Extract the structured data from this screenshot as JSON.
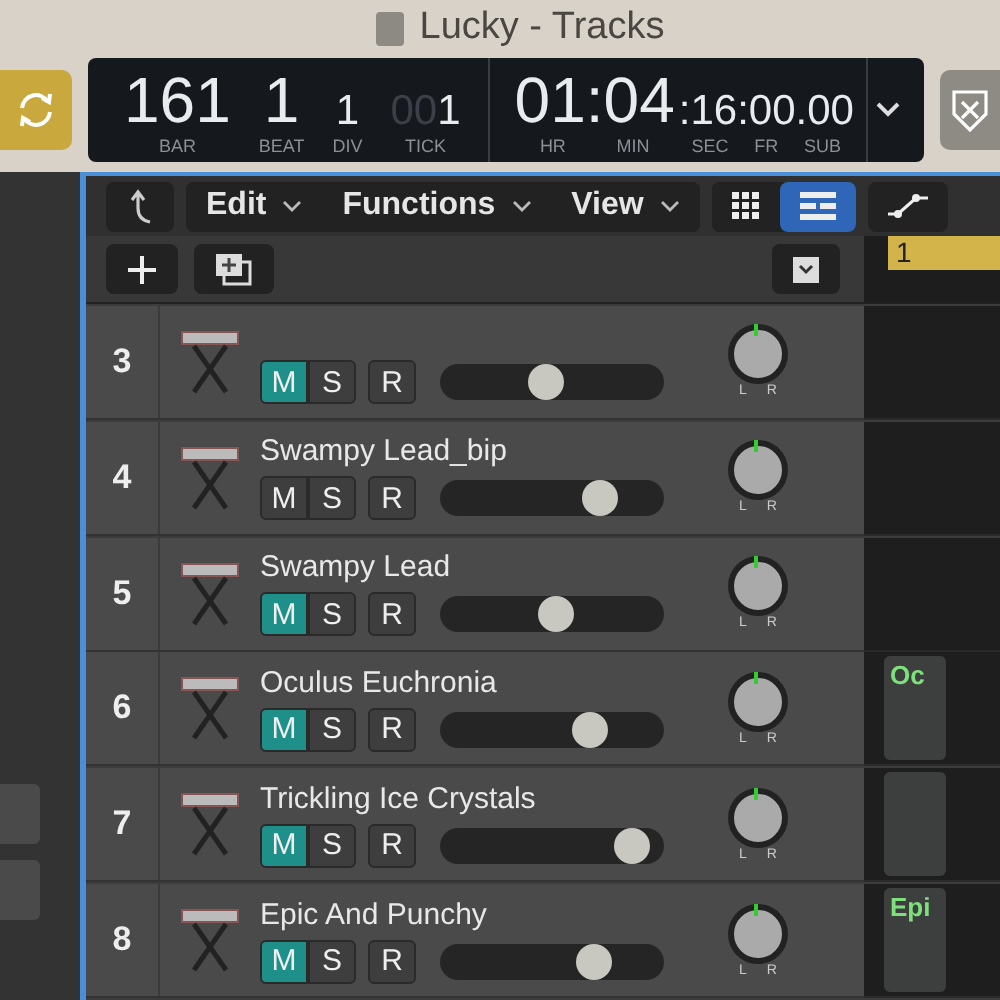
{
  "window": {
    "title": "Lucky - Tracks"
  },
  "transport": {
    "cycle_on": true,
    "position_major": [
      {
        "value": "161",
        "label": "BAR"
      },
      {
        "value": "1",
        "label": "BEAT"
      }
    ],
    "position_minor": [
      {
        "value": "1",
        "label": "DIV"
      },
      {
        "dim": "00",
        "value": "1",
        "label": "TICK"
      }
    ],
    "time_major": {
      "text": "01:04",
      "labels": [
        "HR",
        "MIN"
      ]
    },
    "time_minor": {
      "text": ":16:00.00",
      "labels": [
        "SEC",
        "FR",
        "SUB"
      ]
    }
  },
  "toolbar": {
    "menus": [
      "Edit",
      "Functions",
      "View"
    ],
    "views": [
      {
        "kind": "grid",
        "selected": false
      },
      {
        "kind": "list",
        "selected": true
      }
    ]
  },
  "ruler": {
    "marker": "1"
  },
  "tracks": [
    {
      "number": "3",
      "mute": true,
      "solo": false,
      "record": false,
      "level": 0.47,
      "pan": [
        "L",
        "R"
      ],
      "buttons": [
        "M",
        "S",
        "R"
      ],
      "region": false
    },
    {
      "number": "4",
      "name": "Swampy Lead_bip",
      "mute": false,
      "solo": false,
      "record": false,
      "level": 0.75,
      "pan": [
        "L",
        "R"
      ],
      "buttons": [
        "M",
        "S",
        "R"
      ],
      "region": false
    },
    {
      "number": "5",
      "name": "Swampy Lead",
      "mute": true,
      "solo": false,
      "record": false,
      "level": 0.52,
      "pan": [
        "L",
        "R"
      ],
      "buttons": [
        "M",
        "S",
        "R"
      ],
      "region": false
    },
    {
      "number": "6",
      "name": "Oculus Euchronia",
      "mute": true,
      "solo": false,
      "record": false,
      "level": 0.7,
      "pan": [
        "L",
        "R"
      ],
      "buttons": [
        "M",
        "S",
        "R"
      ],
      "region": true,
      "region_label": "Oc"
    },
    {
      "number": "7",
      "name": "Trickling Ice Crystals",
      "mute": true,
      "solo": false,
      "record": false,
      "level": 0.93,
      "pan": [
        "L",
        "R"
      ],
      "buttons": [
        "M",
        "S",
        "R"
      ],
      "region": true
    },
    {
      "number": "8",
      "name": "Epic And Punchy",
      "mute": true,
      "solo": false,
      "record": false,
      "level": 0.72,
      "pan": [
        "L",
        "R"
      ],
      "buttons": [
        "M",
        "S",
        "R"
      ],
      "region": true,
      "region_label": "Epi"
    }
  ]
}
